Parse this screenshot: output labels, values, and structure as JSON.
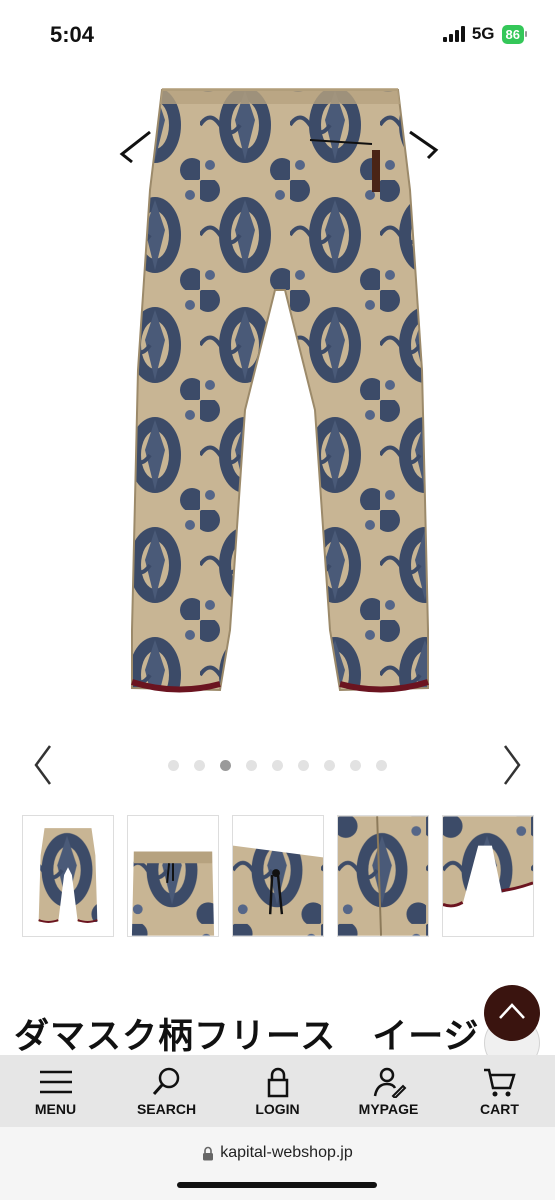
{
  "status_bar": {
    "time": "5:04",
    "network": "5G",
    "battery": "86"
  },
  "gallery": {
    "main_image": "damask-fleece-pants-back",
    "dots": 9,
    "active_index": 2,
    "thumbnails": [
      "pants-full",
      "waist-front",
      "waist-detail",
      "fabric-closeup",
      "hem-detail"
    ]
  },
  "product": {
    "title": "ダマスク柄フリース　イージ"
  },
  "bottom_nav": {
    "items": [
      {
        "label": "MENU",
        "icon": "menu-icon"
      },
      {
        "label": "SEARCH",
        "icon": "search-icon"
      },
      {
        "label": "LOGIN",
        "icon": "lock-icon"
      },
      {
        "label": "MYPAGE",
        "icon": "user-edit-icon"
      },
      {
        "label": "CART",
        "icon": "cart-icon"
      }
    ]
  },
  "browser": {
    "url": "kapital-webshop.jp"
  },
  "colors": {
    "accent": "#3a140f",
    "fabric_base": "#c8b594",
    "fabric_pattern": "#3c4b68",
    "hem": "#6b1420"
  }
}
